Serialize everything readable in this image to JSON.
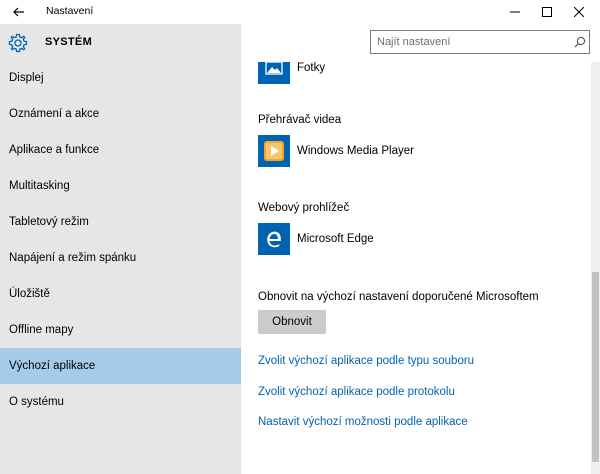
{
  "window": {
    "title": "Nastavení"
  },
  "header": {
    "section_title": "SYSTÉM"
  },
  "search": {
    "placeholder": "Najít nastavení"
  },
  "sidebar": {
    "items": [
      {
        "label": "Displej",
        "active": false
      },
      {
        "label": "Oznámení a akce",
        "active": false
      },
      {
        "label": "Aplikace a funkce",
        "active": false
      },
      {
        "label": "Multitasking",
        "active": false
      },
      {
        "label": "Tabletový režim",
        "active": false
      },
      {
        "label": "Napájení a režim spánku",
        "active": false
      },
      {
        "label": "Úložiště",
        "active": false
      },
      {
        "label": "Offline mapy",
        "active": false
      },
      {
        "label": "Výchozí aplikace",
        "active": true
      },
      {
        "label": "O systému",
        "active": false
      }
    ]
  },
  "main": {
    "photos": {
      "app_name": "Fotky",
      "icon": "photos-icon",
      "tile_color": "#0063b1"
    },
    "video": {
      "section_label": "Přehrávač videa",
      "app_name": "Windows Media Player",
      "icon": "media-player-icon",
      "tile_color": "#0063b1"
    },
    "browser": {
      "section_label": "Webový prohlížeč",
      "app_name": "Microsoft Edge",
      "icon": "edge-icon",
      "tile_color": "#0063b1"
    },
    "reset": {
      "label": "Obnovit na výchozí nastavení doporučené Microsoftem",
      "button": "Obnovit"
    },
    "links": [
      "Zvolit výchozí aplikace podle typu souboru",
      "Zvolit výchozí aplikace podle protokolu",
      "Nastavit výchozí možnosti podle aplikace"
    ]
  },
  "colors": {
    "accent": "#0063b1",
    "link": "#0063b1",
    "sidebar_bg": "#e6e6e6",
    "sidebar_active": "#a5cbe8",
    "button_bg": "#cccccc"
  }
}
